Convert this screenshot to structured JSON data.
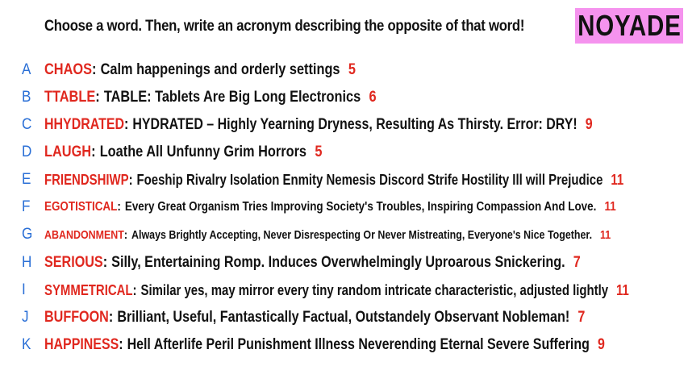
{
  "prompt": "Choose a word. Then, write an acronym describing the opposite of that word!",
  "badge": "NOYADE",
  "colors": {
    "badge_bg": "#f593ee",
    "word": "#e0281f",
    "letter": "#2a6fd6",
    "number": "#e0281f",
    "text": "#111111"
  },
  "rows": [
    {
      "letter": "A",
      "word": "CHAOS",
      "sep": ":",
      "text": "Calm happenings and orderly settings",
      "number": "5"
    },
    {
      "letter": "B",
      "word": "TTABLE",
      "sep": ":",
      "text": "TABLE: Tablets Are Big Long Electronics",
      "number": "6"
    },
    {
      "letter": "C",
      "word": "HHYDRATED",
      "sep": ":",
      "text": "HYDRATED – Highly Yearning Dryness, Resulting As Thirsty. Error: DRY!",
      "number": "9"
    },
    {
      "letter": "D",
      "word": "LAUGH",
      "sep": ":",
      "text": "Loathe All Unfunny Grim Horrors",
      "number": "5"
    },
    {
      "letter": "E",
      "word": "FRIENDSHIWP",
      "sep": ":",
      "text": "Foeship Rivalry Isolation Enmity Nemesis Discord Strife Hostility Ill will Prejudice",
      "number": "11"
    },
    {
      "letter": "F",
      "word": "EGOTISTICAL",
      "sep": ":",
      "text": "Every Great Organism Tries Improving Society's Troubles, Inspiring Compassion And Love.",
      "number": "11"
    },
    {
      "letter": "G",
      "word": "ABANDONMENT",
      "sep": ":",
      "text": "Always Brightly Accepting, Never Disrespecting Or Never Mistreating, Everyone's Nice Together.",
      "number": "11"
    },
    {
      "letter": "H",
      "word": "SERIOUS",
      "sep": ":",
      "text": "Silly, Entertaining Romp. Induces Overwhelmingly Uproarous Snickering.",
      "number": "7"
    },
    {
      "letter": "I",
      "word": "SYMMETRICAL",
      "sep": ":",
      "text": "Similar yes, may mirror every tiny random intricate characteristic, adjusted lightly",
      "number": "11"
    },
    {
      "letter": "J",
      "word": "BUFFOON",
      "sep": ":",
      "text": "Brilliant, Useful, Fantastically Factual, Outstandely Observant Nobleman!",
      "number": "7"
    },
    {
      "letter": "K",
      "word": "HAPPINESS",
      "sep": ":",
      "text": "Hell Afterlife Peril Punishment Illness Neverending Eternal Severe Suffering",
      "number": "9"
    }
  ]
}
